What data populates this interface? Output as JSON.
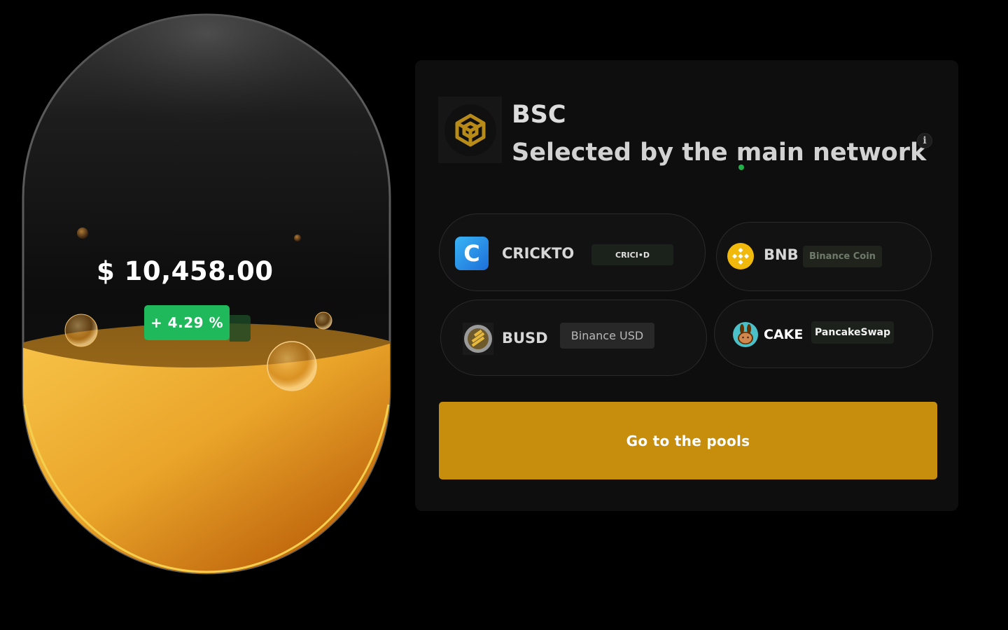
{
  "wallet": {
    "balance": "$ 10,458.00",
    "change": "+ 4.29 %"
  },
  "network": {
    "name": "BSC",
    "subtitle": "Selected by the main network",
    "logo_icon": "bsc-cube-icon",
    "info_icon": "info-icon",
    "info_label": "i"
  },
  "tokens": [
    {
      "symbol": "CRICKTO",
      "name": "CRICI•D",
      "icon": "crickto-logo-icon",
      "color": "#2a8fe8"
    },
    {
      "symbol": "BNB",
      "name": "Binance Coin",
      "icon": "bnb-logo-icon",
      "color": "#f0b90b"
    },
    {
      "symbol": "BUSD",
      "name": "Binance USD",
      "icon": "busd-logo-icon",
      "color": "#e6b93e"
    },
    {
      "symbol": "CAKE",
      "name": "PancakeSwap",
      "icon": "pancakeswap-bunny-icon",
      "color": "#4bc0c8"
    }
  ],
  "cta": {
    "label": "Go to the pools"
  },
  "colors": {
    "accent": "#c78e0d",
    "positive": "#1fb85a",
    "panel": "#0e0e0e",
    "liquid": "#e8a020"
  }
}
